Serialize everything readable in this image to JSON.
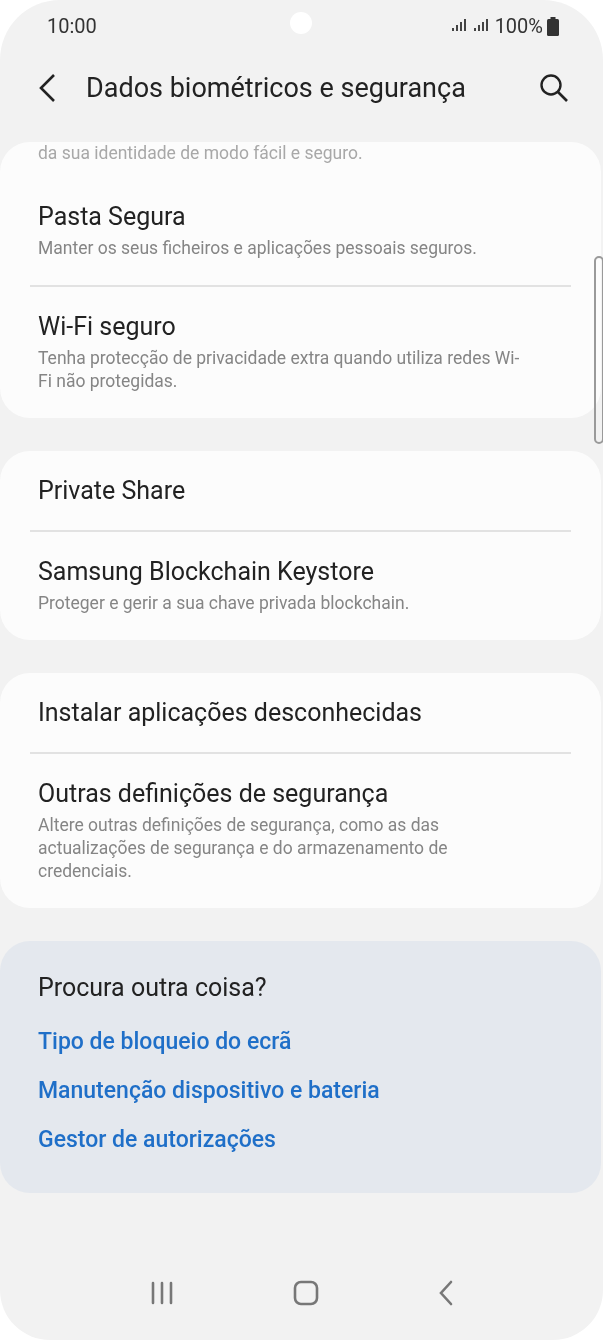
{
  "status_bar": {
    "time": "10:00",
    "battery": "100%"
  },
  "app_bar": {
    "title": "Dados biométricos e segurança"
  },
  "groups": [
    {
      "items": [
        {
          "subtitle": "da sua identidade de modo fácil e seguro.",
          "kind": "partial"
        },
        {
          "title": "Pasta Segura",
          "subtitle": "Manter os seus ficheiros e aplicações pessoais seguros.",
          "kind": "item"
        },
        {
          "title": "Wi-Fi seguro",
          "subtitle": "Tenha protecção de privacidade extra quando utiliza redes Wi-Fi não protegidas.",
          "kind": "item"
        }
      ]
    },
    {
      "items": [
        {
          "title": "Private Share",
          "kind": "item"
        },
        {
          "title": "Samsung Blockchain Keystore",
          "subtitle": "Proteger e gerir a sua chave privada blockchain.",
          "kind": "item"
        }
      ]
    },
    {
      "items": [
        {
          "title": "Instalar aplicações desconhecidas",
          "kind": "item"
        },
        {
          "title": "Outras definições de segurança",
          "subtitle": "Altere outras definições de segurança, como as das actualizações de segurança e do armazenamento de credenciais.",
          "kind": "item"
        }
      ]
    }
  ],
  "suggestions": {
    "title": "Procura outra coisa?",
    "links": [
      "Tipo de bloqueio do ecrã",
      "Manutenção dispositivo e bateria",
      "Gestor de autorizações"
    ]
  }
}
